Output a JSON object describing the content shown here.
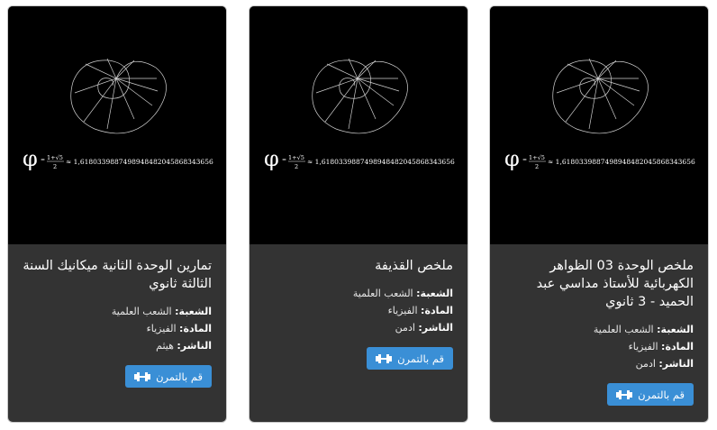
{
  "cards": [
    {
      "title": "ملخص الوحدة 03 الظواهر الكهربائية للأستاذ مداسي عبد الحميد - 3 ثانوي",
      "branch_label": "الشعبة:",
      "branch": "الشعب العلمية",
      "subject_label": "المادة:",
      "subject": "الفيزياء",
      "publisher_label": "الناشر:",
      "publisher": "ادمن",
      "button_label": "قم بالتمرن",
      "button_icon": "dumbbell-icon"
    },
    {
      "title": "ملخص القذيفة",
      "branch_label": "الشعبة:",
      "branch": "الشعب العلمية",
      "subject_label": "المادة:",
      "subject": "الفيزياء",
      "publisher_label": "الناشر:",
      "publisher": "ادمن",
      "button_label": "قم بالتمرن",
      "button_icon": "dumbbell-icon"
    },
    {
      "title": "تمارين الوحدة الثانية ميكانيك السنة الثالثة ثانوي",
      "branch_label": "الشعبة:",
      "branch": "الشعب العلمية",
      "subject_label": "المادة:",
      "subject": "الفيزياء",
      "publisher_label": "الناشر:",
      "publisher": "هيثم",
      "button_label": "قم بالتمرن",
      "button_icon": "dumbbell-icon"
    }
  ],
  "thumbnail": {
    "phi": "φ",
    "numerator": "1+√5",
    "denominator": "2",
    "value": "≈ 1,6180339887498948482045868343656"
  },
  "colors": {
    "card_bg": "#333333",
    "button_bg": "#3a8fd6",
    "image_bg": "#000000"
  }
}
